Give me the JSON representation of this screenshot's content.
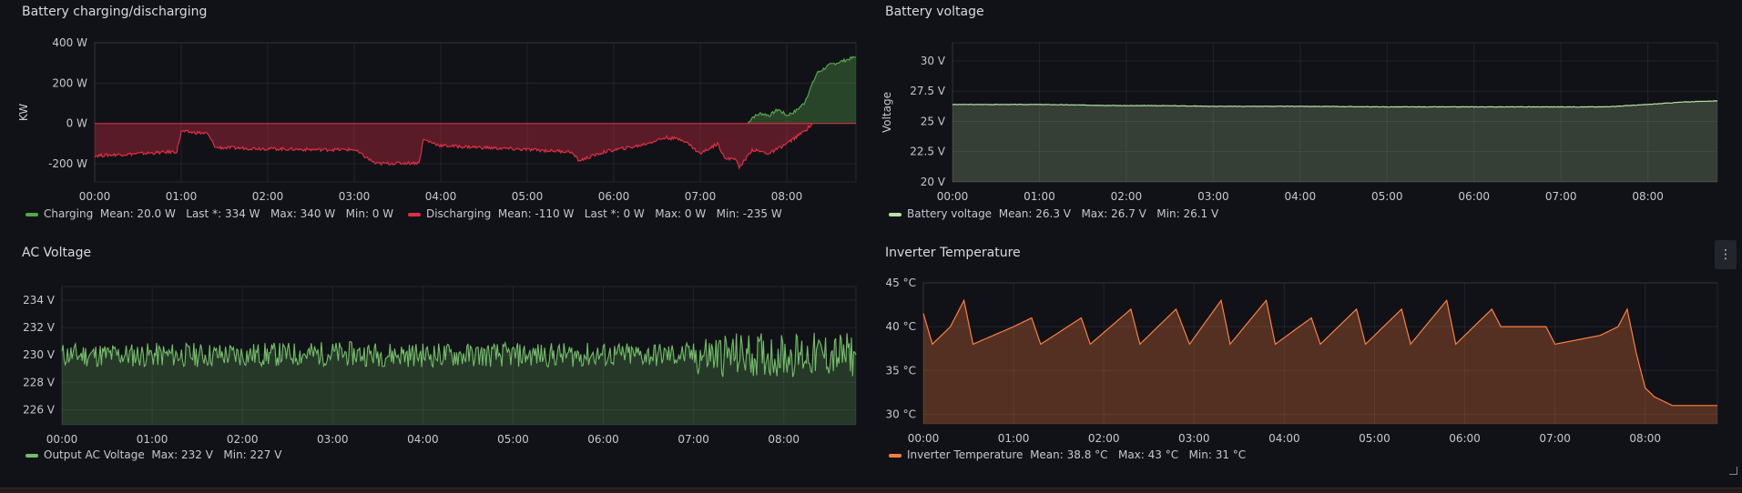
{
  "x_ticks": [
    "00:00",
    "01:00",
    "02:00",
    "03:00",
    "04:00",
    "05:00",
    "06:00",
    "07:00",
    "08:00"
  ],
  "menu_icon": "⋮",
  "chart_data": [
    {
      "id": "battery",
      "type": "area",
      "title": "Battery charging/discharging",
      "ylabel": "KW",
      "yticks": [
        "400 W",
        "200 W",
        "0 W",
        "-200 W"
      ],
      "ylim": [
        -290,
        400
      ],
      "series": [
        {
          "name": "Charging",
          "color": "#56a64b",
          "legend": "Mean: 20.0 W   Last *: 334 W   Max: 340 W   Min: 0 W",
          "points": [
            [
              7.55,
              0
            ],
            [
              7.6,
              30
            ],
            [
              7.7,
              50
            ],
            [
              7.8,
              40
            ],
            [
              7.9,
              70
            ],
            [
              8.0,
              40
            ],
            [
              8.1,
              60
            ],
            [
              8.2,
              100
            ],
            [
              8.35,
              250
            ],
            [
              8.5,
              290
            ],
            [
              8.65,
              310
            ],
            [
              8.8,
              330
            ]
          ]
        },
        {
          "name": "Discharging",
          "color": "#e02f44",
          "legend": "Mean: -110 W   Last *: 0 W   Max: 0 W   Min: -235 W",
          "points": [
            [
              0,
              -160
            ],
            [
              0.5,
              -150
            ],
            [
              0.95,
              -140
            ],
            [
              1.0,
              -40
            ],
            [
              1.3,
              -50
            ],
            [
              1.4,
              -120
            ],
            [
              2.0,
              -125
            ],
            [
              2.5,
              -130
            ],
            [
              3.0,
              -130
            ],
            [
              3.25,
              -200
            ],
            [
              3.75,
              -195
            ],
            [
              3.8,
              -80
            ],
            [
              4.0,
              -110
            ],
            [
              4.5,
              -120
            ],
            [
              5.0,
              -130
            ],
            [
              5.5,
              -140
            ],
            [
              5.6,
              -185
            ],
            [
              5.9,
              -140
            ],
            [
              6.3,
              -110
            ],
            [
              6.6,
              -70
            ],
            [
              6.8,
              -80
            ],
            [
              7.0,
              -150
            ],
            [
              7.2,
              -100
            ],
            [
              7.3,
              -180
            ],
            [
              7.4,
              -170
            ],
            [
              7.45,
              -220
            ],
            [
              7.6,
              -130
            ],
            [
              7.8,
              -150
            ],
            [
              8.0,
              -100
            ],
            [
              8.2,
              -40
            ],
            [
              8.3,
              0
            ]
          ]
        }
      ]
    },
    {
      "id": "battvolt",
      "type": "area",
      "title": "Battery voltage",
      "ylabel": "Voltage",
      "yticks": [
        "30 V",
        "27.5 V",
        "25 V",
        "22.5 V",
        "20 V"
      ],
      "ylim": [
        20,
        31.5
      ],
      "series": [
        {
          "name": "Battery voltage",
          "color": "#b8e1a8",
          "legend": "Mean: 26.3 V   Max: 26.7 V   Min: 26.1 V",
          "points": [
            [
              0,
              26.4
            ],
            [
              0.5,
              26.4
            ],
            [
              1.0,
              26.4
            ],
            [
              1.5,
              26.35
            ],
            [
              2.0,
              26.3
            ],
            [
              2.5,
              26.3
            ],
            [
              3.0,
              26.25
            ],
            [
              3.5,
              26.25
            ],
            [
              4.0,
              26.25
            ],
            [
              5.0,
              26.2
            ],
            [
              6.0,
              26.2
            ],
            [
              7.0,
              26.2
            ],
            [
              7.5,
              26.2
            ],
            [
              8.0,
              26.4
            ],
            [
              8.4,
              26.6
            ],
            [
              8.8,
              26.7
            ]
          ]
        }
      ]
    },
    {
      "id": "acvolt",
      "type": "area",
      "title": "AC Voltage",
      "ylabel": "",
      "yticks": [
        "234 V",
        "232 V",
        "230 V",
        "228 V",
        "226 V"
      ],
      "ylim": [
        224.9,
        235
      ],
      "series": [
        {
          "name": "Output AC Voltage",
          "color": "#73bf69",
          "legend": "Max: 232 V   Min: 227 V",
          "points": [
            [
              0,
              230.0
            ],
            [
              1.0,
              230.0
            ],
            [
              2.0,
              230.0
            ],
            [
              3.0,
              230.1
            ],
            [
              4.0,
              230.0
            ],
            [
              5.0,
              230.0
            ],
            [
              6.0,
              230.0
            ],
            [
              7.0,
              230.0
            ],
            [
              8.0,
              230.0
            ],
            [
              8.8,
              230.0
            ]
          ]
        }
      ]
    },
    {
      "id": "temp",
      "type": "area",
      "title": "Inverter Temperature",
      "ylabel": "",
      "yticks": [
        "45 °C",
        "40 °C",
        "35 °C",
        "30 °C"
      ],
      "ylim": [
        28.9,
        45
      ],
      "series": [
        {
          "name": "Inverter Temperature",
          "color": "#ff7f3f",
          "legend": "Mean: 38.8 °C   Max: 43 °C   Min: 31 °C",
          "points": [
            [
              0,
              41.5
            ],
            [
              0.1,
              38
            ],
            [
              0.3,
              40
            ],
            [
              0.45,
              43
            ],
            [
              0.55,
              38
            ],
            [
              1.0,
              40
            ],
            [
              1.2,
              41
            ],
            [
              1.3,
              38
            ],
            [
              1.75,
              41
            ],
            [
              1.85,
              38
            ],
            [
              2.3,
              42
            ],
            [
              2.4,
              38
            ],
            [
              2.8,
              42
            ],
            [
              2.95,
              38
            ],
            [
              3.3,
              43
            ],
            [
              3.4,
              38
            ],
            [
              3.8,
              43
            ],
            [
              3.9,
              38
            ],
            [
              4.3,
              41
            ],
            [
              4.4,
              38
            ],
            [
              4.8,
              42
            ],
            [
              4.9,
              38
            ],
            [
              5.3,
              42
            ],
            [
              5.4,
              38
            ],
            [
              5.8,
              43
            ],
            [
              5.9,
              38
            ],
            [
              6.3,
              42
            ],
            [
              6.4,
              40
            ],
            [
              6.9,
              40
            ],
            [
              7.0,
              38
            ],
            [
              7.5,
              39
            ],
            [
              7.7,
              40
            ],
            [
              7.8,
              42
            ],
            [
              7.9,
              37
            ],
            [
              8.0,
              33
            ],
            [
              8.1,
              32
            ],
            [
              8.3,
              31
            ],
            [
              8.8,
              31
            ]
          ]
        }
      ]
    }
  ]
}
